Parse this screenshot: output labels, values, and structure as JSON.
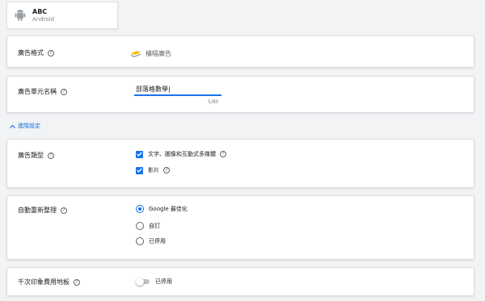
{
  "app": {
    "name": "ABC",
    "platform": "Android",
    "icon": "android-icon"
  },
  "ad_format": {
    "label": "廣告格式",
    "value": "橫幅廣告",
    "icon": "banner-icon"
  },
  "ad_unit_name": {
    "label": "廣告單元名稱",
    "value": "部落格數學|",
    "counter": "5/80"
  },
  "advanced_settings": {
    "label": "進階設定",
    "expanded": true
  },
  "ad_type": {
    "label": "廣告類型",
    "options": [
      {
        "label": "文字、圖像和互動式多媒體",
        "checked": true
      },
      {
        "label": "影片",
        "checked": true
      }
    ]
  },
  "auto_refresh": {
    "label": "自動重新整理",
    "options": [
      {
        "label": "Google 最佳化",
        "selected": true
      },
      {
        "label": "自訂",
        "selected": false
      },
      {
        "label": "已停用",
        "selected": false
      }
    ]
  },
  "ecpm_floor": {
    "label": "千次印象費用地板",
    "state_label": "已停用",
    "enabled": false
  },
  "colors": {
    "accent": "#1a73e8",
    "background": "#f1f3f4"
  }
}
